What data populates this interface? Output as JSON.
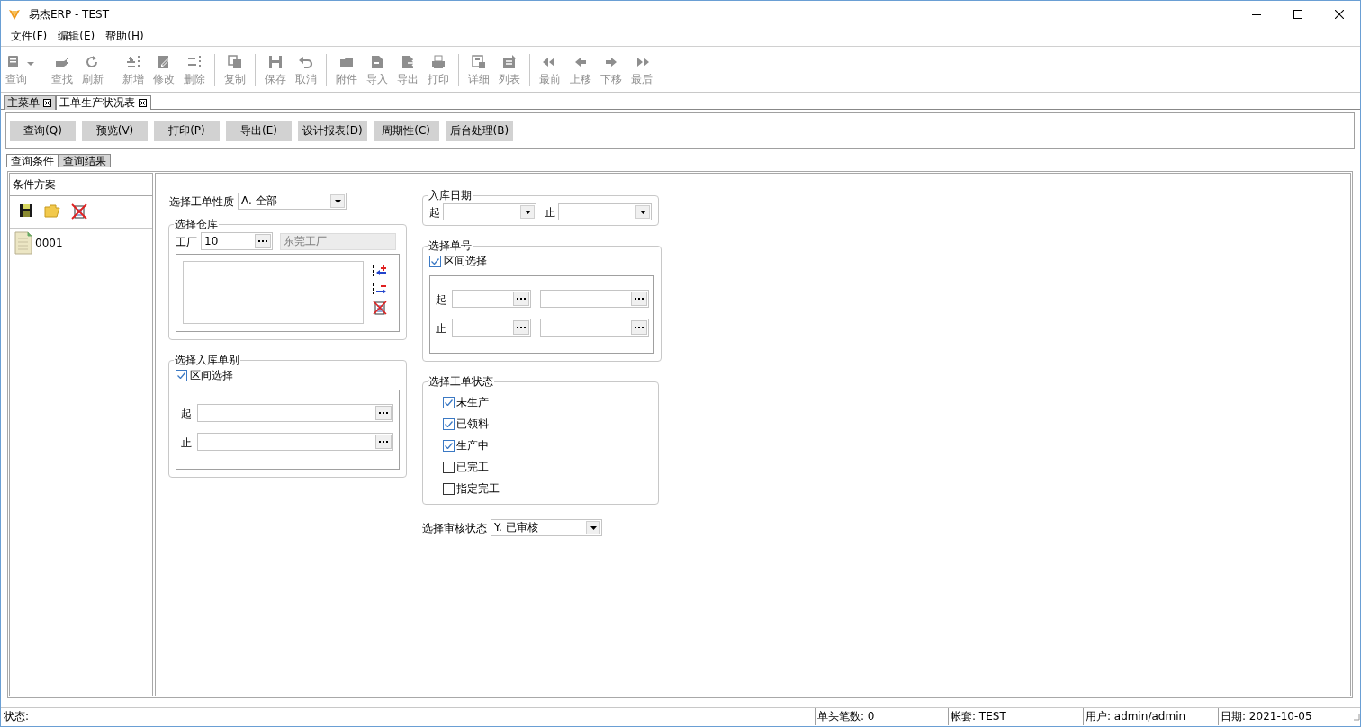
{
  "window": {
    "title": "易杰ERP - TEST"
  },
  "menu": [
    {
      "label": "文件(F)"
    },
    {
      "label": "编辑(E)"
    },
    {
      "label": "帮助(H)"
    }
  ],
  "toolbar": {
    "groups": [
      [
        {
          "label": "查询",
          "disabled": true,
          "kind": "dropdown"
        },
        {
          "label": "查找",
          "disabled": true,
          "kind": "plain"
        },
        {
          "label": "刷新",
          "disabled": true,
          "kind": "plain"
        }
      ],
      [
        {
          "label": "新增",
          "disabled": true,
          "kind": "plain"
        },
        {
          "label": "修改",
          "disabled": true,
          "kind": "plain"
        },
        {
          "label": "删除",
          "disabled": true,
          "kind": "plain"
        }
      ],
      [
        {
          "label": "复制",
          "disabled": true,
          "kind": "plain"
        }
      ],
      [
        {
          "label": "保存",
          "disabled": true,
          "kind": "plain"
        },
        {
          "label": "取消",
          "disabled": true,
          "kind": "plain"
        }
      ],
      [
        {
          "label": "附件",
          "disabled": true,
          "kind": "plain"
        },
        {
          "label": "导入",
          "disabled": true,
          "kind": "plain"
        },
        {
          "label": "导出",
          "disabled": true,
          "kind": "plain"
        },
        {
          "label": "打印",
          "disabled": true,
          "kind": "plain"
        }
      ],
      [
        {
          "label": "详细",
          "disabled": true,
          "kind": "plain"
        },
        {
          "label": "列表",
          "disabled": true,
          "kind": "plain"
        }
      ],
      [
        {
          "label": "最前",
          "disabled": true,
          "kind": "plain"
        },
        {
          "label": "上移",
          "disabled": true,
          "kind": "plain"
        },
        {
          "label": "下移",
          "disabled": true,
          "kind": "plain"
        },
        {
          "label": "最后",
          "disabled": true,
          "kind": "plain"
        }
      ]
    ]
  },
  "doc_tabs": [
    {
      "label": "主菜单",
      "selected": false
    },
    {
      "label": "工单生产状况表",
      "selected": true
    }
  ],
  "actions": [
    "查询(Q)",
    "预览(V)",
    "打印(P)",
    "导出(E)",
    "设计报表(D)",
    "周期性(C)",
    "后台处理(B)"
  ],
  "query_tabs": [
    {
      "label": "查询条件",
      "selected": true
    },
    {
      "label": "查询结果",
      "selected": false
    }
  ],
  "scheme_panel": {
    "title": "条件方案",
    "items": [
      {
        "label": "0001"
      }
    ]
  },
  "form": {
    "order_type": {
      "label": "选择工单性质",
      "value": "A. 全部"
    },
    "warehouse": {
      "title": "选择仓库",
      "factory_label": "工厂",
      "factory_code": "10",
      "factory_name": "东莞工厂"
    },
    "receipt_type": {
      "title": "选择入库单别",
      "range_label": "区间选择",
      "range_checked": true,
      "from_label": "起",
      "to_label": "止"
    },
    "receipt_date": {
      "title": "入库日期",
      "from_label": "起",
      "to_label": "止"
    },
    "order_no": {
      "title": "选择单号",
      "range_label": "区间选择",
      "range_checked": true,
      "from_label": "起",
      "to_label": "止"
    },
    "status": {
      "title": "选择工单状态",
      "options": [
        {
          "label": "未生产",
          "checked": true
        },
        {
          "label": "已领料",
          "checked": true
        },
        {
          "label": "生产中",
          "checked": true
        },
        {
          "label": "已完工",
          "checked": false
        },
        {
          "label": "指定完工",
          "checked": false
        }
      ]
    },
    "audit": {
      "label": "选择审核状态",
      "value": "Y. 已审核"
    }
  },
  "status_bar": {
    "label": "状态:",
    "fields": [
      "单头笔数: 0",
      "帐套: TEST",
      "用户: admin/admin",
      "日期: 2021-10-05"
    ]
  }
}
